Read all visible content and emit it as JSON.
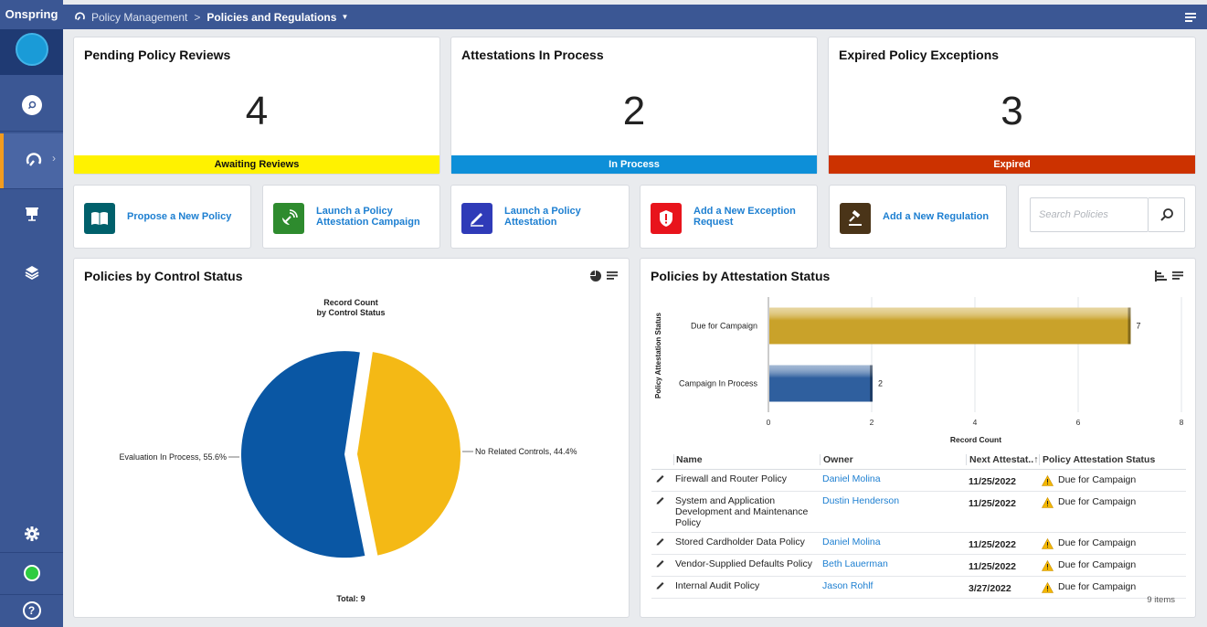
{
  "brand": "Onspring",
  "breadcrumb": {
    "parent": "Policy Management",
    "separator": ">",
    "current": "Policies and Regulations"
  },
  "metrics": [
    {
      "title": "Pending Policy Reviews",
      "value": "4",
      "status": "Awaiting Reviews",
      "color": "#fff200",
      "text_color": "#111111"
    },
    {
      "title": "Attestations In Process",
      "value": "2",
      "status": "In Process",
      "color": "#0d8fd8",
      "text_color": "#ffffff"
    },
    {
      "title": "Expired Policy Exceptions",
      "value": "3",
      "status": "Expired",
      "color": "#cc3200",
      "text_color": "#ffffff"
    }
  ],
  "actions": [
    {
      "label": "Propose a New Policy",
      "icon": "book-icon",
      "color": "#00606b"
    },
    {
      "label": "Launch a Policy Attestation Campaign",
      "icon": "satellite-icon",
      "color": "#2e8b2e"
    },
    {
      "label": "Launch a Policy Attestation",
      "icon": "pen-icon",
      "color": "#2f3bb8"
    },
    {
      "label": "Add a New Exception Request",
      "icon": "alert-shield-icon",
      "color": "#e8141c"
    },
    {
      "label": "Add a New Regulation",
      "icon": "gavel-icon",
      "color": "#4a3418"
    }
  ],
  "search": {
    "placeholder": "Search Policies"
  },
  "control_panel": {
    "title": "Policies by Control Status",
    "chart_title_line1": "Record Count",
    "chart_title_line2": "by Control Status",
    "total": "Total: 9"
  },
  "attestation_panel": {
    "title": "Policies by Attestation Status",
    "ylabel": "Policy Attestation Status",
    "xlabel": "Record Count",
    "items_count": "9 items",
    "columns": [
      "Name",
      "Owner",
      "Next Attestat..↑",
      "Policy Attestation Status"
    ],
    "rows": [
      {
        "name": "Firewall and Router Policy",
        "owner": "Daniel Molina",
        "date": "11/25/2022",
        "status": "Due for Campaign"
      },
      {
        "name": "System and Application Development and Maintenance Policy",
        "owner": "Dustin Henderson",
        "date": "11/25/2022",
        "status": "Due for Campaign"
      },
      {
        "name": "Stored Cardholder Data Policy",
        "owner": "Daniel Molina",
        "date": "11/25/2022",
        "status": "Due for Campaign"
      },
      {
        "name": "Vendor-Supplied Defaults Policy",
        "owner": "Beth Lauerman",
        "date": "11/25/2022",
        "status": "Due for Campaign"
      },
      {
        "name": "Internal Audit Policy",
        "owner": "Jason Rohlf",
        "date": "3/27/2022",
        "status": "Due for Campaign"
      }
    ]
  },
  "chart_data": [
    {
      "type": "pie",
      "title": "Record Count by Control Status",
      "categories": [
        "Evaluation In Process",
        "No Related Controls"
      ],
      "values": [
        5,
        4
      ],
      "labels": [
        "Evaluation In Process, 55.6%",
        "No Related Controls, 44.4%"
      ],
      "colors": [
        "#0a57a4",
        "#f4b915"
      ],
      "total": 9
    },
    {
      "type": "bar",
      "orientation": "horizontal",
      "categories": [
        "Due for Campaign",
        "Campaign In Process"
      ],
      "values": [
        7,
        2
      ],
      "xlabel": "Record Count",
      "ylabel": "Policy Attestation Status",
      "xlim": [
        0,
        8
      ],
      "ticks": [
        0,
        2,
        4,
        6,
        8
      ],
      "colors": [
        "#c9a22a",
        "#2f5f9e"
      ],
      "grid": true
    }
  ]
}
